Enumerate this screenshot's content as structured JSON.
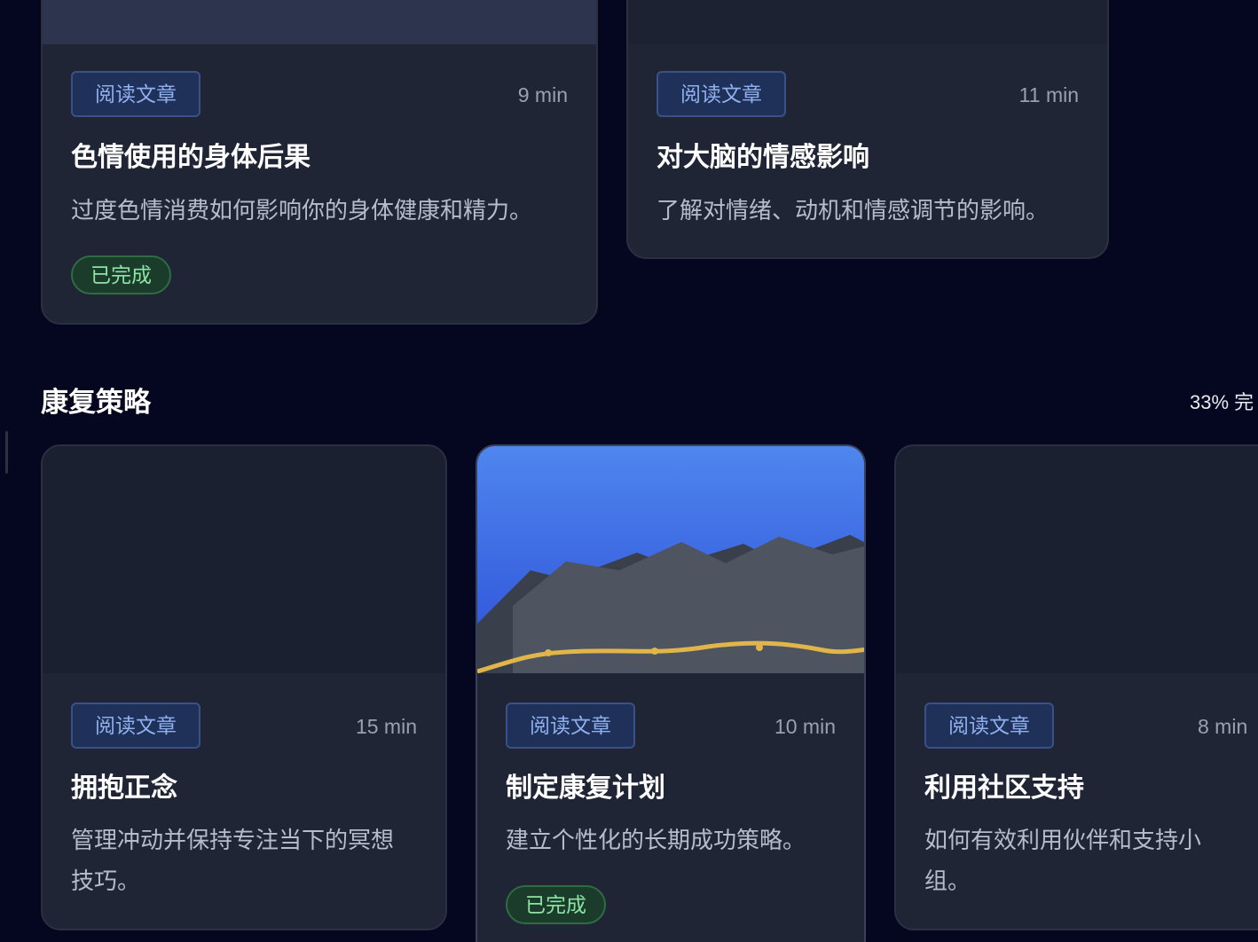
{
  "top_cards": [
    {
      "tag": "阅读文章",
      "duration": "9 min",
      "title": "色情使用的身体后果",
      "description": "过度色情消费如何影响你的身体健康和精力。",
      "status": "已完成"
    },
    {
      "tag": "阅读文章",
      "duration": "11 min",
      "title": "对大脑的情感影响",
      "description": "了解对情绪、动机和情感调节的影响。"
    }
  ],
  "section": {
    "title": "康复策略",
    "progress": "33% 完"
  },
  "cards": [
    {
      "tag": "阅读文章",
      "duration": "15 min",
      "title": "拥抱正念",
      "description": "管理冲动并保持专注当下的冥想技巧。"
    },
    {
      "tag": "阅读文章",
      "duration": "10 min",
      "title": "制定康复计划",
      "description": "建立个性化的长期成功策略。",
      "status": "已完成"
    },
    {
      "tag": "阅读文章",
      "duration": "8 min",
      "title": "利用社区支持",
      "description": "如何有效利用伙伴和支持小组。"
    }
  ],
  "colors": {
    "background": "#05061f",
    "card": "#1f2535",
    "tag_text": "#8fb0ee",
    "completed_text": "#8be3a4",
    "chart_line": "#e0b54a"
  }
}
